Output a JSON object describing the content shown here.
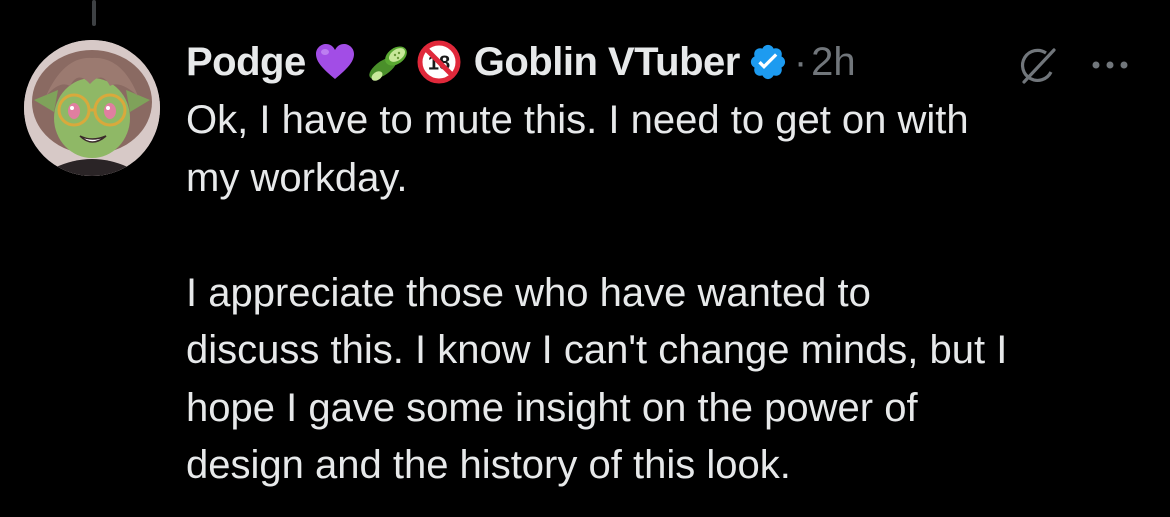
{
  "tweet": {
    "display_name": "Podge",
    "name_suffix": "Goblin VTuber",
    "separator": "·",
    "time_ago": "2h",
    "body": "Ok, I have to mute this. I need to get on with\nmy workday.\n\nI appreciate those who have wanted to\ndiscuss this. I know I can't change minds, but I\nhope I gave some insight on the power of\ndesign and the history of this look."
  },
  "icons": {
    "name_emojis": [
      "purple-heart",
      "cucumber",
      "no-one-under-eighteen"
    ],
    "verified": "verified-badge-icon",
    "grok": "grok-icon",
    "more": "more-options-icon"
  },
  "colors": {
    "background": "#000000",
    "text": "#e7e9ea",
    "secondary": "#71767b",
    "verified_blue": "#1d9bf0",
    "thread_line": "#3e4144"
  }
}
